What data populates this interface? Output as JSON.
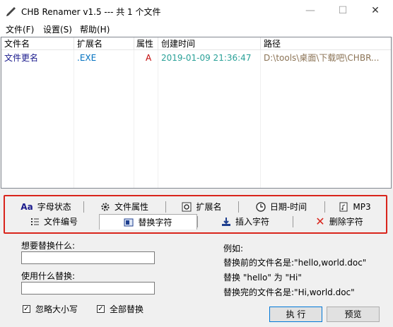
{
  "window": {
    "title": "CHB Renamer v1.5 --- 共 1 个文件",
    "min_glyph": "—",
    "max_glyph": "☐",
    "close_glyph": "✕"
  },
  "menu": [
    "文件(F)",
    "设置(S)",
    "帮助(H)"
  ],
  "list": {
    "columns": [
      "文件名",
      "扩展名",
      "属性",
      "创建时间",
      "路径"
    ],
    "rows": [
      {
        "name": "文件更名",
        "ext": ".EXE",
        "attr": "A",
        "created": "2019-01-09 21:36:47",
        "path": "D:\\tools\\桌面\\下载吧\\CHBR..."
      }
    ]
  },
  "tabs_row1": [
    {
      "label": "字母状态",
      "icon": "Aa"
    },
    {
      "label": "文件属性",
      "icon": "gear"
    },
    {
      "label": "扩展名",
      "icon": "ext"
    },
    {
      "label": "日期-时间",
      "icon": "clock"
    },
    {
      "label": "MP3",
      "icon": "music"
    }
  ],
  "tabs_row2": [
    {
      "label": "文件编号",
      "icon": "list"
    },
    {
      "label": "替换字符",
      "icon": "replace",
      "active": true
    },
    {
      "label": "插入字符",
      "icon": "insert"
    },
    {
      "label": "删除字符",
      "icon": "delete"
    }
  ],
  "form": {
    "find_label": "想要替换什么:",
    "find_value": "",
    "replace_label": "使用什么替换:",
    "replace_value": "",
    "ignore_case_label": "忽略大小写",
    "ignore_case_checked": true,
    "replace_all_label": "全部替换",
    "replace_all_checked": true
  },
  "example": {
    "heading": "例如:",
    "line1": "替换前的文件名是:\"hello,world.doc\"",
    "line2": "替换 \"hello\" 为 \"Hi\"",
    "line3": "替换完的文件名是:\"Hi,world.doc\""
  },
  "buttons": {
    "execute": "执 行",
    "preview": "预览"
  },
  "colors": {
    "name_text": "#1a1a8c",
    "ext_text": "#0070c0",
    "attr_text": "#c00000",
    "date_text": "#2aa198",
    "path_text": "#8b7355",
    "highlight": "#d9251c"
  }
}
